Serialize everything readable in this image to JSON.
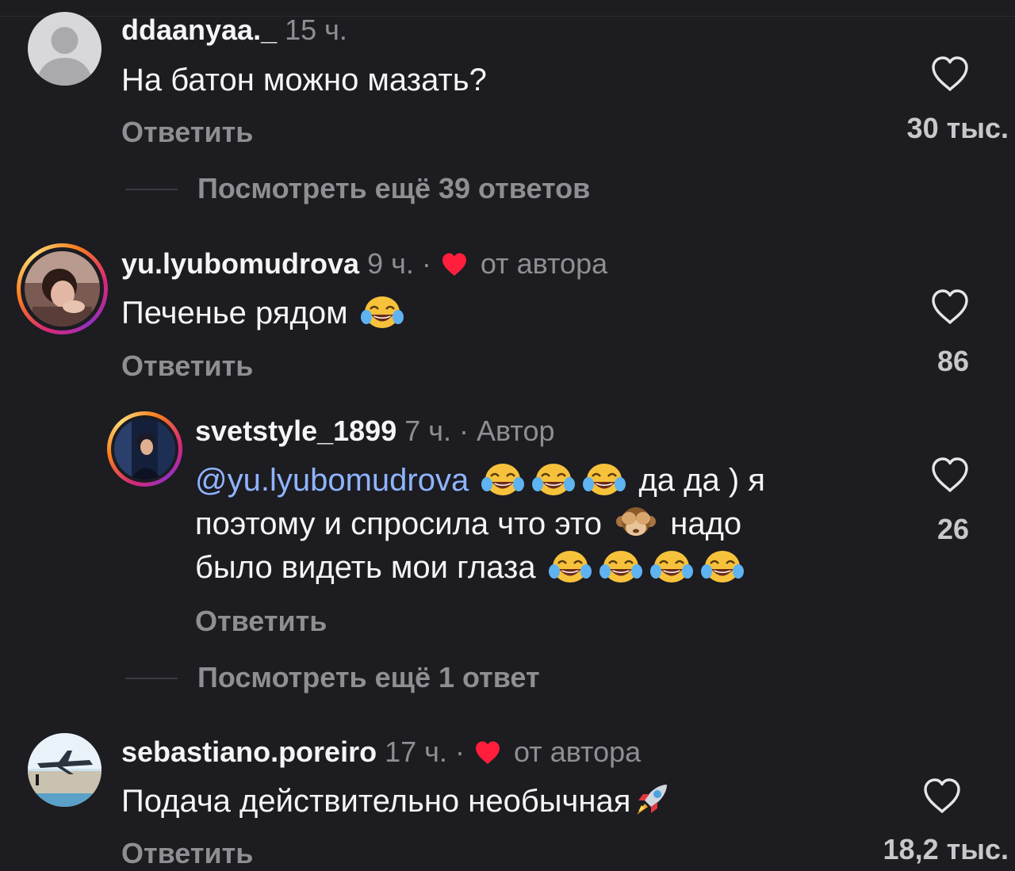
{
  "colors": {
    "background": "#1c1c21",
    "text_primary": "#f5f5f5",
    "text_secondary": "#8e8e93",
    "mention": "#8fb4ff",
    "heart_red": "#ff1f3d"
  },
  "comments": [
    {
      "username": "ddaanyaa._",
      "time": "15 ч.",
      "text": "На батон можно мазать?",
      "reply_label": "Ответить",
      "like_count": "30 тыс.",
      "more_replies": "Посмотреть ещё 39 ответов"
    },
    {
      "username": "yu.lyubomudrova",
      "time": "9 ч.",
      "dot": "·",
      "author_tag": "от автора",
      "text": "Печенье рядом",
      "reply_label": "Ответить",
      "like_count": "86",
      "reply": {
        "username": "svetstyle_1899",
        "time": "7 ч.",
        "dot": "·",
        "author_tag": "Автор",
        "mention": "@yu.lyubomudrova",
        "text_1": "да да ) я",
        "text_2a": "поэтому и спросила что это",
        "text_2b": "надо",
        "text_3": "было видеть мои глаза",
        "reply_label": "Ответить",
        "like_count": "26"
      },
      "more_replies": "Посмотреть ещё 1 ответ"
    },
    {
      "username": "sebastiano.poreiro",
      "time": "17 ч.",
      "dot": "·",
      "author_tag": "от автора",
      "text": "Подача действительно необычная",
      "reply_label": "Ответить",
      "like_count": "18,2 тыс."
    }
  ],
  "icons": {
    "like": "heart-outline-icon",
    "author_like": "red-heart-icon",
    "laugh": "tears-of-joy-emoji",
    "monkey": "see-no-evil-monkey-emoji",
    "rocket": "rocket-emoji"
  }
}
